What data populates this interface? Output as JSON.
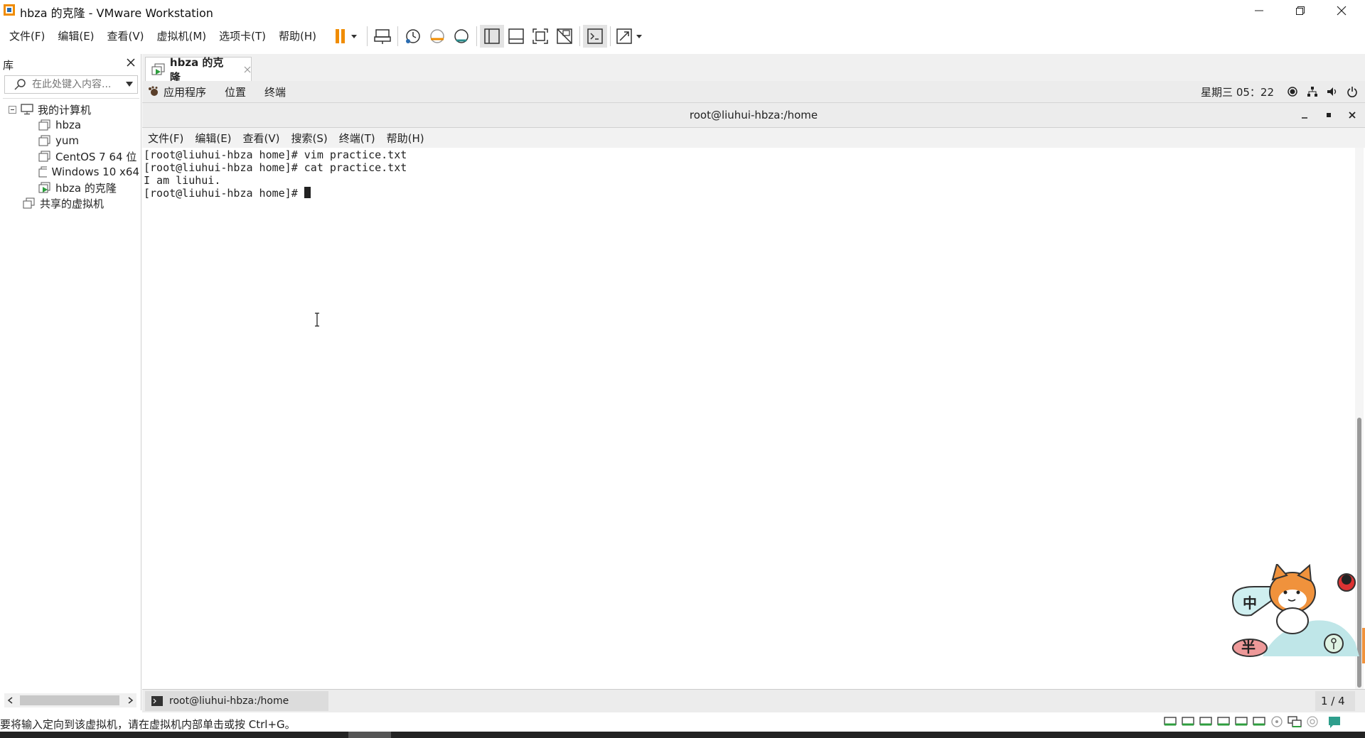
{
  "window": {
    "title": "hbza 的克隆 - VMware Workstation"
  },
  "menubar": {
    "items": [
      "文件(F)",
      "编辑(E)",
      "查看(V)",
      "虚拟机(M)",
      "选项卡(T)",
      "帮助(H)"
    ]
  },
  "library": {
    "title": "库",
    "search_placeholder": "在此处键入内容...",
    "tree": {
      "root": "我的计算机",
      "vms": [
        "hbza",
        "yum",
        "CentOS 7 64 位",
        "Windows 10 x64",
        "hbza 的克隆"
      ],
      "shared": "共享的虚拟机"
    }
  },
  "vm_tab": {
    "label": "hbza 的克隆"
  },
  "gnome": {
    "menus": [
      "应用程序",
      "位置",
      "终端"
    ],
    "clock": "星期三 05：22"
  },
  "terminal": {
    "title": "root@liuhui-hbza:/home",
    "menus": [
      "文件(F)",
      "编辑(E)",
      "查看(V)",
      "搜索(S)",
      "终端(T)",
      "帮助(H)"
    ],
    "lines": [
      "[root@liuhui-hbza home]# vim practice.txt",
      "[root@liuhui-hbza home]# cat practice.txt",
      "I am liuhui.",
      "[root@liuhui-hbza home]# "
    ]
  },
  "taskbar": {
    "item": "root@liuhui-hbza:/home",
    "pager": "1 / 4"
  },
  "statusbar": {
    "text": "要将输入定向到该虚拟机，请在虚拟机内部单击或按 Ctrl+G。"
  },
  "colors": {
    "accent_orange": "#f08c00",
    "toolbar_blue": "#2b6cb0",
    "mascot_orange": "#f0923c"
  }
}
